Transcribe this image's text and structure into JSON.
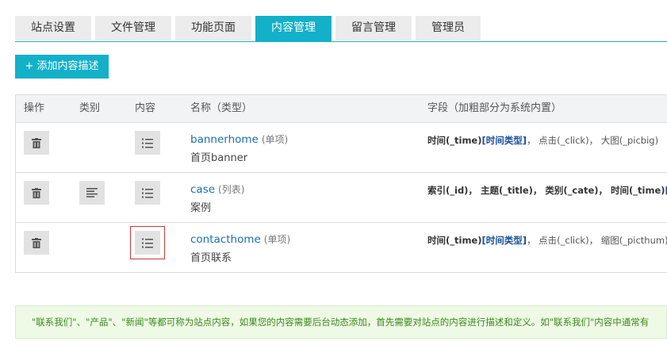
{
  "tabs": [
    {
      "label": "站点设置"
    },
    {
      "label": "文件管理"
    },
    {
      "label": "功能页面"
    },
    {
      "label": "内容管理",
      "active": true
    },
    {
      "label": "留言管理"
    },
    {
      "label": "管理员"
    }
  ],
  "add_button": "+ 添加内容描述",
  "table": {
    "headers": {
      "action": "操作",
      "category": "类别",
      "content": "内容",
      "name": "名称（类型）",
      "fields": "字段（加粗部分为系统内置）"
    },
    "rows": [
      {
        "name": "bannerhome",
        "type": "(单项)",
        "desc": "首页banner",
        "fields_a": "时间(_time)",
        "fields_hl": "[时间类型]",
        "fields_b": "， 点击(_click)， 大图(_picbig)"
      },
      {
        "name": "case",
        "type": "(列表)",
        "desc": "案例",
        "fields_a": "索引(_id)， 主题(_title)， 类别(_cate)， 时间(_time)",
        "fields_hl": "[时",
        "fields_b": ""
      },
      {
        "name": "contacthome",
        "type": "(单项)",
        "desc": "首页联系",
        "fields_a": "时间(_time)",
        "fields_hl": "[时间类型]",
        "fields_b": "， 点击(_click)， 缩图(_picthum)，"
      }
    ]
  },
  "notice": "\"联系我们\"、\"产品\"、\"新闻\"等都可称为站点内容，如果您的内容需要后台动态添加，首先需要对站点的内容进行描述和定义。如\"联系我们\"内容中通常有",
  "colors": {
    "accent": "#13b0c9",
    "link": "#1a6fb0",
    "selected_outline": "#d23535",
    "notice_text": "#3c8a1a"
  }
}
